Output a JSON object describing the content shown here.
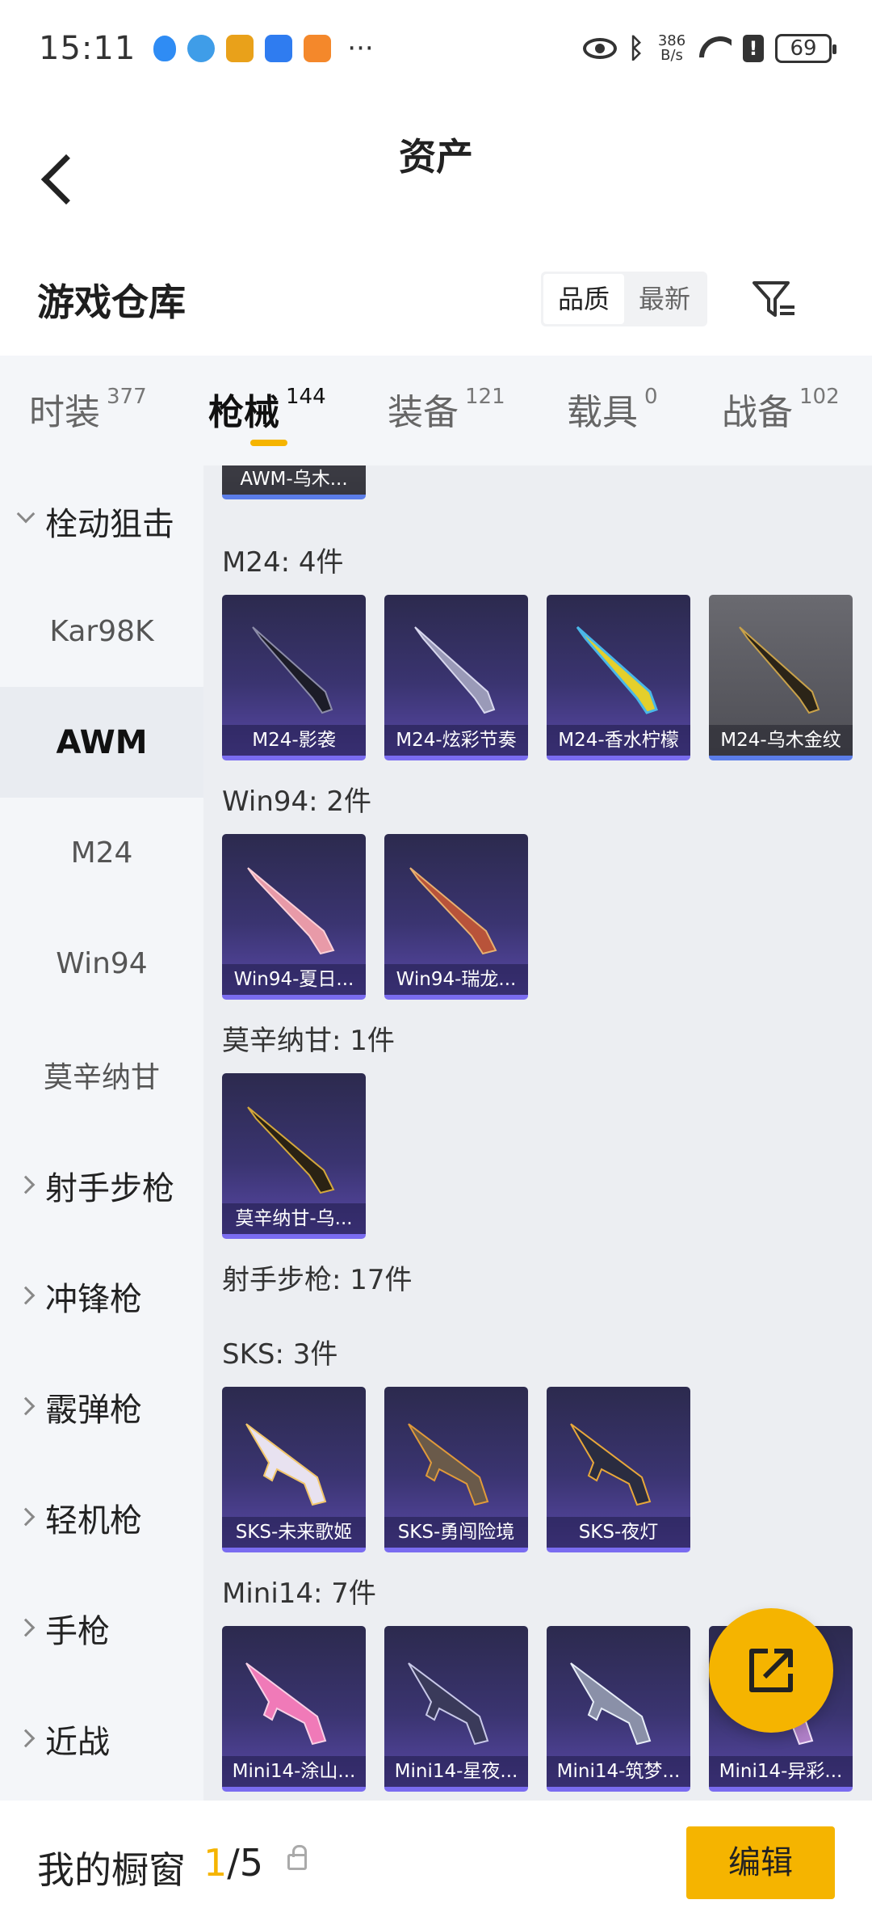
{
  "status_bar": {
    "time": "15:11",
    "net_speed_value": "386",
    "net_speed_unit": "B/s",
    "battery": "69",
    "more": "···"
  },
  "nav": {
    "title": "资产"
  },
  "section": {
    "title": "游戏仓库",
    "sort_options": [
      "品质",
      "最新"
    ],
    "active_sort": "品质"
  },
  "tabs": [
    {
      "label": "时装",
      "count": "377"
    },
    {
      "label": "枪械",
      "count": "144"
    },
    {
      "label": "装备",
      "count": "121"
    },
    {
      "label": "载具",
      "count": "0"
    },
    {
      "label": "战备",
      "count": "102"
    }
  ],
  "active_tab": "枪械",
  "side_nav": [
    {
      "label": "栓动狙击",
      "type": "group",
      "expanded": true
    },
    {
      "label": "Kar98K",
      "type": "item"
    },
    {
      "label": "AWM",
      "type": "item",
      "active": true
    },
    {
      "label": "M24",
      "type": "item"
    },
    {
      "label": "Win94",
      "type": "item"
    },
    {
      "label": "莫辛纳甘",
      "type": "item"
    },
    {
      "label": "射手步枪",
      "type": "group"
    },
    {
      "label": "冲锋枪",
      "type": "group"
    },
    {
      "label": "霰弹枪",
      "type": "group"
    },
    {
      "label": "轻机枪",
      "type": "group"
    },
    {
      "label": "手枪",
      "type": "group"
    },
    {
      "label": "近战",
      "type": "group"
    }
  ],
  "groups": {
    "awm_partial": {
      "cards": [
        "AWM-乌木..."
      ]
    },
    "m24": {
      "label": "M24: 4件",
      "cards": [
        "M24-影袭",
        "M24-炫彩节奏",
        "M24-香水柠檬",
        "M24-乌木金纹"
      ]
    },
    "win94": {
      "label": "Win94: 2件",
      "cards": [
        "Win94-夏日...",
        "Win94-瑞龙..."
      ]
    },
    "mosin": {
      "label": "莫辛纳甘: 1件",
      "cards": [
        "莫辛纳甘-乌..."
      ]
    },
    "dmr": {
      "label": "射手步枪: 17件"
    },
    "sks": {
      "label": "SKS: 3件",
      "cards": [
        "SKS-未来歌姬",
        "SKS-勇闯险境",
        "SKS-夜灯"
      ]
    },
    "mini14": {
      "label": "Mini14: 7件",
      "cards": [
        "Mini14-涂山...",
        "Mini14-星夜...",
        "Mini14-筑梦...",
        "Mini14-异彩..."
      ]
    }
  },
  "bottom_bar": {
    "title": "我的橱窗",
    "current": "1",
    "total": "/5",
    "edit_label": "编辑"
  },
  "colors": {
    "accent": "#f5b400",
    "card_border": "#7a6cf0"
  }
}
